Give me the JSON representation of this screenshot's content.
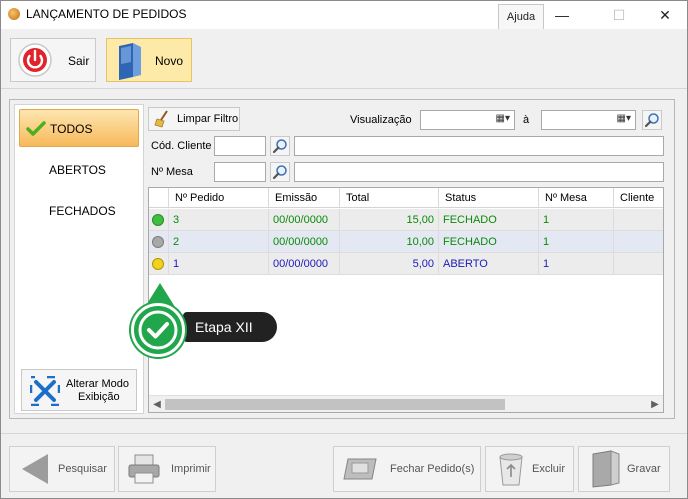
{
  "window": {
    "title": "LANÇAMENTO DE PEDIDOS",
    "help_label": "Ajuda",
    "minimize": "—",
    "maximize": "☐",
    "close": "✕"
  },
  "toolbar": {
    "exit_label": "Sair",
    "new_label": "Novo"
  },
  "sidebar": {
    "items": [
      {
        "label": "TODOS",
        "active": true
      },
      {
        "label": "ABERTOS",
        "active": false
      },
      {
        "label": "FECHADOS",
        "active": false
      }
    ],
    "mode_button": {
      "line1": "Alterar Modo",
      "line2": "Exibição"
    }
  },
  "filters": {
    "clear_label": "Limpar Filtro",
    "visualization_label": "Visualização",
    "to_label": "à",
    "client_code_label": "Cód. Cliente",
    "table_number_label": "Nº Mesa",
    "date_from": "",
    "date_to": "",
    "client_code": "",
    "client_name": "",
    "table_number": "",
    "table_desc": ""
  },
  "grid": {
    "columns": [
      "Nº Pedido",
      "Emissão",
      "Total",
      "Status",
      "Nº Mesa",
      "Cliente"
    ],
    "rows": [
      {
        "status_color": "#3fbf3f",
        "pedido": "3",
        "emissao": "00/00/0000",
        "total": "15,00",
        "status": "FECHADO",
        "mesa": "1",
        "cliente": ""
      },
      {
        "status_color": "#a8a8a8",
        "pedido": "2",
        "emissao": "00/00/0000",
        "total": "10,00",
        "status": "FECHADO",
        "mesa": "1",
        "cliente": ""
      },
      {
        "status_color": "#f2d21a",
        "pedido": "1",
        "emissao": "00/00/0000",
        "total": "5,00",
        "status": "ABERTO",
        "mesa": "1",
        "cliente": ""
      }
    ],
    "scroll_left": "◀",
    "scroll_right": "▶"
  },
  "callout": {
    "label": "Etapa XII"
  },
  "bottom": {
    "search_label": "Pesquisar",
    "print_label": "Imprimir",
    "close_orders_label": "Fechar Pedido(s)",
    "delete_label": "Excluir",
    "save_label": "Gravar"
  },
  "colors": {
    "closed_text": "#0b8a0b",
    "open_text": "#1b1bb8",
    "accent": "#22a64b"
  }
}
